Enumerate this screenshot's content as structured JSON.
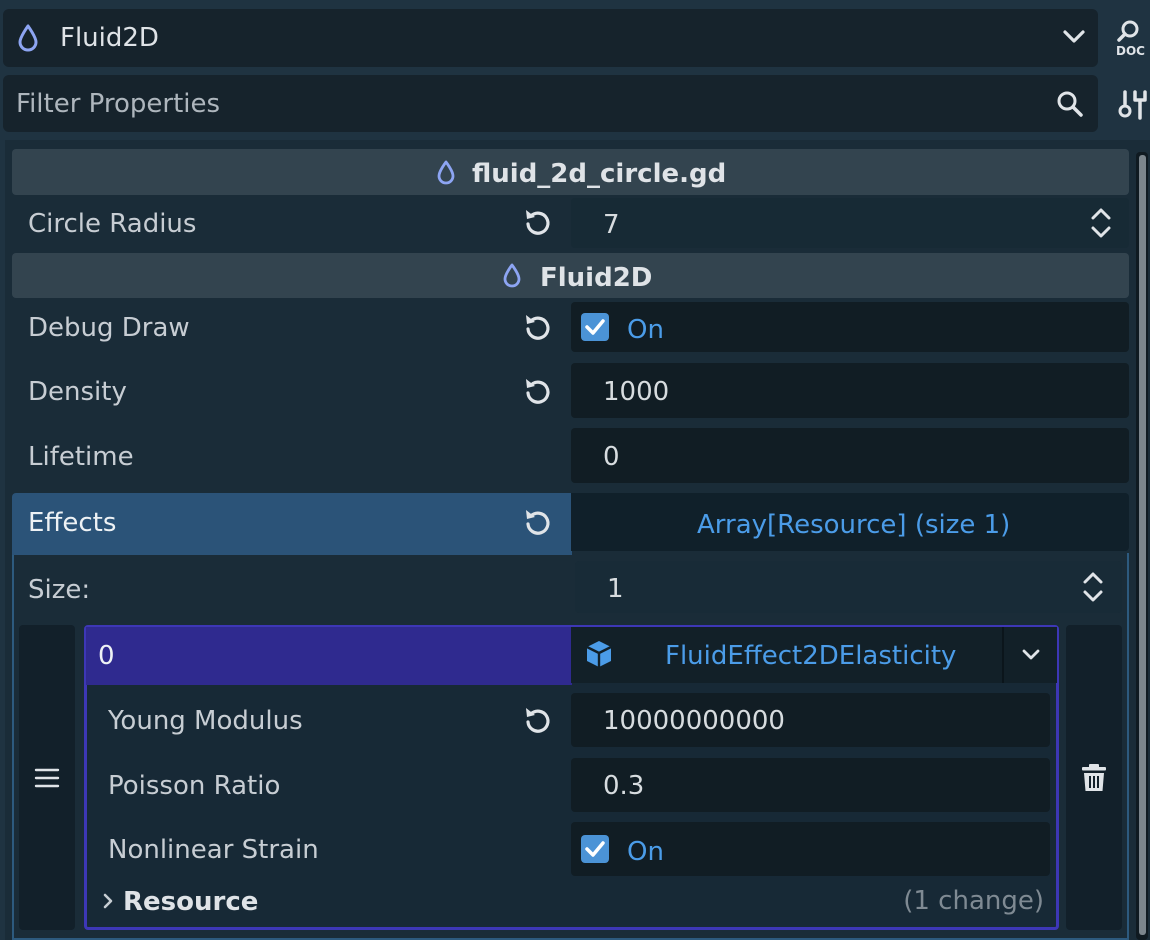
{
  "header": {
    "node_name": "Fluid2D",
    "doc_icon": "doc-search-icon",
    "filter_placeholder": "Filter Properties",
    "search_icon": "search-icon",
    "tools_icon": "tools-icon"
  },
  "script_section": {
    "title": "fluid_2d_circle.gd",
    "icon": "droplet-icon",
    "properties": [
      {
        "label": "Circle Radius",
        "value": "7"
      }
    ]
  },
  "class_section": {
    "title": "Fluid2D",
    "icon": "droplet-icon",
    "properties": [
      {
        "label": "Debug Draw",
        "checked": true,
        "value": "On"
      },
      {
        "label": "Density",
        "value": "1000"
      },
      {
        "label": "Lifetime",
        "value": "0"
      }
    ]
  },
  "effects": {
    "label": "Effects",
    "value": "Array[Resource] (size 1)",
    "size_label": "Size:",
    "size_value": "1",
    "element": {
      "index": "0",
      "type": "FluidEffect2DElasticity",
      "properties": [
        {
          "label": "Young Modulus",
          "value": "10000000000"
        },
        {
          "label": "Poisson Ratio",
          "value": "0.3"
        },
        {
          "label": "Nonlinear Strain",
          "checked": true,
          "value": "On"
        }
      ],
      "resource_group": {
        "label": "Resource",
        "changes": "(1 change)"
      }
    }
  },
  "colors": {
    "accent_blue": "#4b9ce8",
    "checkbox_blue": "#4b93d6",
    "array_element_purple": "#3d37b6",
    "effects_selected": "#2b5378"
  }
}
